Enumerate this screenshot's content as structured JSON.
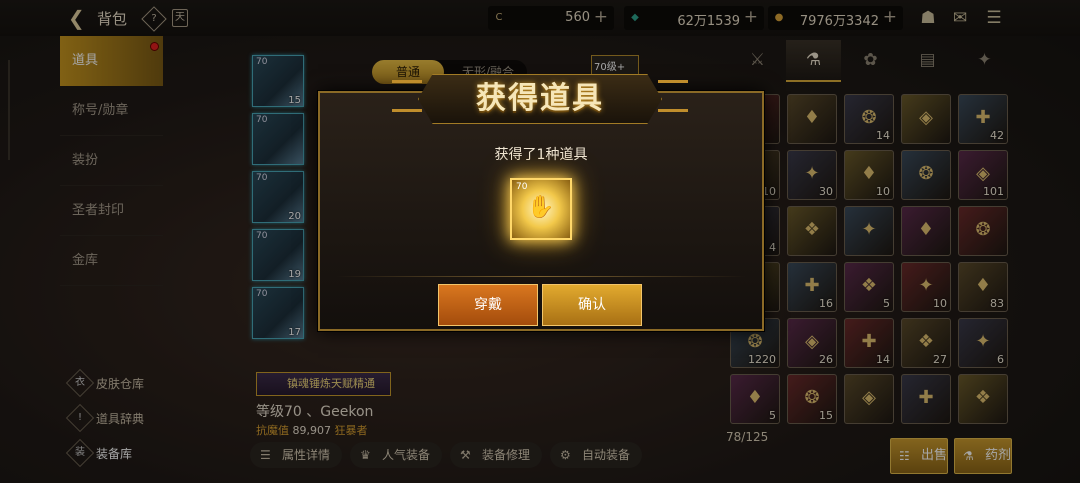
{
  "header": {
    "title": "背包",
    "help_icon": "?",
    "calendar_icon": "天"
  },
  "currencies": [
    {
      "icon": "C",
      "value": "560",
      "plus": "+",
      "color": "#c8b07a"
    },
    {
      "icon": "◆",
      "value": "62万1539",
      "plus": "+",
      "color": "#2fa38c"
    },
    {
      "icon": "●",
      "value": "7976万3342",
      "plus": "+",
      "color": "#d9a43a"
    }
  ],
  "sidebar": {
    "items": [
      {
        "label": "道具"
      },
      {
        "label": "称号/勋章"
      },
      {
        "label": "装扮"
      },
      {
        "label": "圣者封印"
      },
      {
        "label": "金库"
      }
    ],
    "links": [
      {
        "label": "皮肤仓库",
        "icon": "衣"
      },
      {
        "label": "道具辞典",
        "icon": "!"
      },
      {
        "label": "装备库",
        "icon": "装"
      }
    ]
  },
  "equip_slots": [
    {
      "level": "70",
      "count": "15"
    },
    {
      "level": "70",
      "count": ""
    },
    {
      "level": "70",
      "count": "20"
    },
    {
      "level": "70",
      "count": "19"
    },
    {
      "level": "70",
      "count": "17"
    }
  ],
  "center": {
    "tabs": [
      {
        "label": "普通"
      },
      {
        "label": "无形/融合"
      }
    ],
    "char_badge": "70级+",
    "skill_button": "镇魂锤炼天赋精通",
    "char_name": "等级70 、Geekon",
    "stat_label": "抗魔值",
    "stat_value": "89,907",
    "class_name": "狂暴者",
    "bottom_buttons": [
      {
        "label": "属性详情"
      },
      {
        "label": "人气装备"
      },
      {
        "label": "装备修理"
      },
      {
        "label": "自动装备"
      }
    ]
  },
  "inventory": {
    "tabs": [
      {
        "icon": "⚔"
      },
      {
        "icon": "⚗"
      },
      {
        "icon": "✿"
      },
      {
        "icon": "▤"
      },
      {
        "icon": "✦"
      }
    ],
    "rows": [
      [
        {
          "c": ""
        },
        {
          "c": ""
        },
        {
          "c": "14"
        },
        {
          "c": ""
        },
        {
          "c": "42"
        }
      ],
      [
        {
          "c": "10"
        },
        {
          "c": "30"
        },
        {
          "c": "10"
        },
        {
          "c": ""
        },
        {
          "c": "101"
        }
      ],
      [
        {
          "c": "4"
        },
        {
          "c": ""
        },
        {
          "c": ""
        },
        {
          "c": ""
        },
        {
          "c": ""
        }
      ],
      [
        {
          "c": ""
        },
        {
          "c": "16"
        },
        {
          "c": "5"
        },
        {
          "c": "10"
        },
        {
          "c": "83"
        }
      ],
      [
        {
          "c": "1220"
        },
        {
          "c": "26"
        },
        {
          "c": "14"
        },
        {
          "c": "27"
        },
        {
          "c": "6"
        }
      ],
      [
        {
          "c": "5"
        },
        {
          "c": "15"
        },
        {
          "c": ""
        },
        {
          "c": ""
        },
        {
          "c": ""
        }
      ]
    ],
    "count_label": "78/125",
    "sell_label": "出售",
    "potion_label": "药剂"
  },
  "dialog": {
    "title": "获得道具",
    "subtitle": "获得了1种道具",
    "item_level": "70",
    "equip_label": "穿戴",
    "confirm_label": "确认"
  }
}
